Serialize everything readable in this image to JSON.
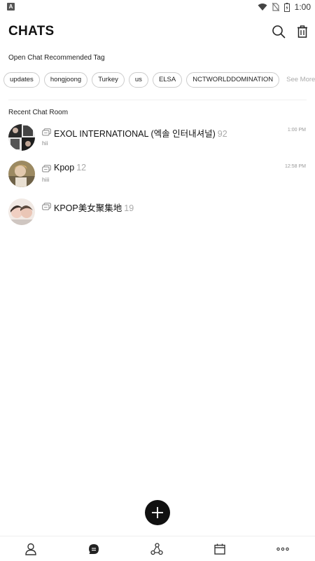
{
  "status": {
    "time": "1:00",
    "indicator_letter": "A"
  },
  "header": {
    "title": "CHATS"
  },
  "open_chat": {
    "section_label": "Open Chat Recommended Tag",
    "tags": [
      "updates",
      "hongjoong",
      "Turkey",
      "us",
      "ELSA",
      "NCTWORLDDOMINATION"
    ],
    "see_more": "See More"
  },
  "recent": {
    "section_label": "Recent Chat Room",
    "rooms": [
      {
        "name": "EXOL INTERNATIONAL (엑솔 인터내셔널)",
        "count": "92",
        "last_message": "hii",
        "time": "1:00 PM"
      },
      {
        "name": "Kpop",
        "count": "12",
        "last_message": "hiii",
        "time": "12:58 PM"
      },
      {
        "name": "KPOP美女聚集地",
        "count": "19",
        "last_message": "",
        "time": ""
      }
    ]
  },
  "colors": {
    "accent": "#111111",
    "muted": "#aaaaaa",
    "border": "#cccccc"
  },
  "icons": {
    "search": "search-icon",
    "delete": "trash-icon",
    "compose": "plus-icon"
  }
}
